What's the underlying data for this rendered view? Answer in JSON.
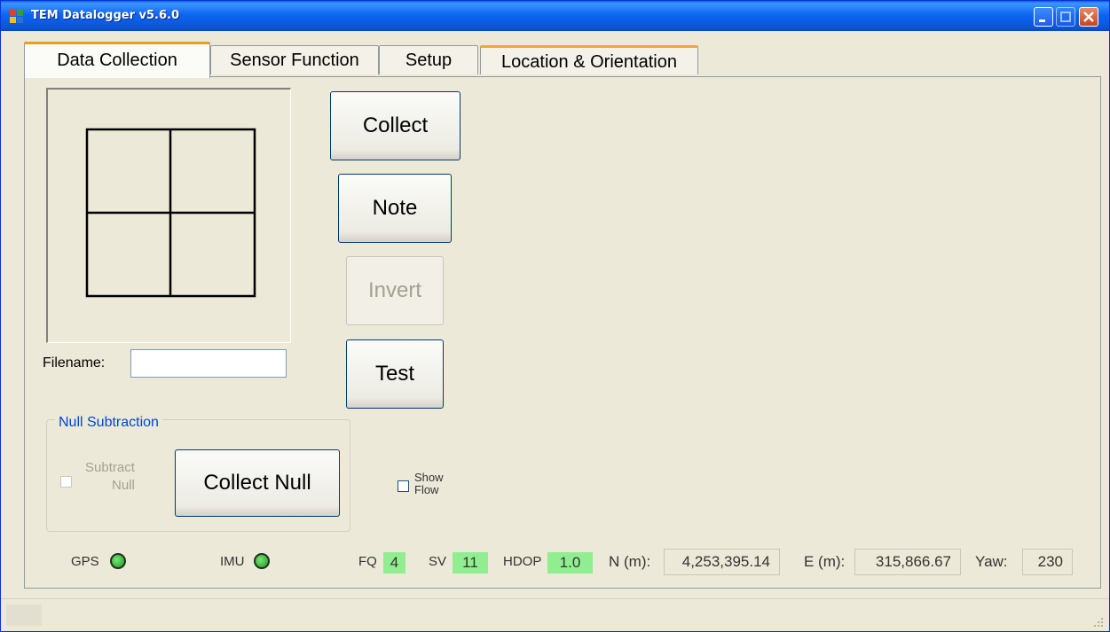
{
  "window": {
    "title": "TEM Datalogger v5.6.0"
  },
  "tabs": [
    {
      "label": "Data Collection"
    },
    {
      "label": "Sensor Function"
    },
    {
      "label": "Setup"
    },
    {
      "label": "Location & Orientation"
    }
  ],
  "buttons": {
    "collect": "Collect",
    "note": "Note",
    "invert": "Invert",
    "test": "Test",
    "collect_null": "Collect Null"
  },
  "filename": {
    "label": "Filename:",
    "value": ""
  },
  "null_subtraction": {
    "title": "Null Subtraction",
    "checkbox_label_1": "Subtract",
    "checkbox_label_2": "Null"
  },
  "show_flow": {
    "label_1": "Show",
    "label_2": "Flow"
  },
  "status": {
    "gps_label": "GPS",
    "imu_label": "IMU",
    "fq_label": "FQ",
    "fq_value": "4",
    "sv_label": "SV",
    "sv_value": "11",
    "hdop_label": "HDOP",
    "hdop_value": "1.0",
    "n_label": "N (m):",
    "n_value": "4,253,395.14",
    "e_label": "E (m):",
    "e_value": "315,866.67",
    "yaw_label": "Yaw:",
    "yaw_value": "230"
  },
  "colors": {
    "indicator_green": "#90ee90",
    "title_blue": "#0a54d8",
    "group_title": "#0046d5"
  },
  "icons": {
    "app": "app-icon",
    "minimize": "minimize-icon",
    "maximize": "maximize-icon",
    "close": "close-icon",
    "led": "led-indicator",
    "grip": "resize-grip-icon"
  }
}
